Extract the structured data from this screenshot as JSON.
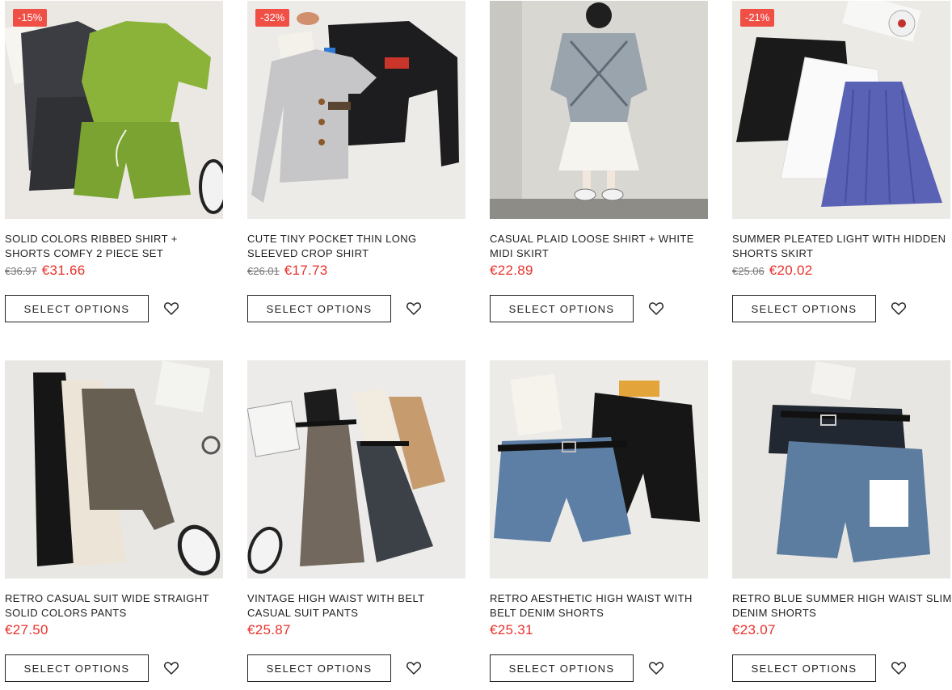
{
  "products": [
    {
      "title": "SOLID COLORS RIBBED SHIRT + SHORTS COMFY 2 PIECE SET",
      "badge": "-15%",
      "old_price": "€36.97",
      "price": "€31.66",
      "button": "SELECT OPTIONS",
      "wishlist_icon": "heart-icon"
    },
    {
      "title": "CUTE TINY POCKET THIN LONG SLEEVED CROP SHIRT",
      "badge": "-32%",
      "old_price": "€26.01",
      "price": "€17.73",
      "button": "SELECT OPTIONS",
      "wishlist_icon": "heart-icon"
    },
    {
      "title": "CASUAL PLAID LOOSE SHIRT + WHITE MIDI SKIRT",
      "badge": null,
      "old_price": null,
      "price": "€22.89",
      "button": "SELECT OPTIONS",
      "wishlist_icon": "heart-icon"
    },
    {
      "title": "SUMMER PLEATED LIGHT WITH HIDDEN SHORTS SKIRT",
      "badge": "-21%",
      "old_price": "€25.06",
      "price": "€20.02",
      "button": "SELECT OPTIONS",
      "wishlist_icon": "heart-icon"
    },
    {
      "title": "RETRO CASUAL SUIT WIDE STRAIGHT SOLID COLORS PANTS",
      "badge": null,
      "old_price": null,
      "price": "€27.50",
      "button": "SELECT OPTIONS",
      "wishlist_icon": "heart-icon"
    },
    {
      "title": "VINTAGE HIGH WAIST WITH BELT CASUAL SUIT PANTS",
      "badge": null,
      "old_price": null,
      "price": "€25.87",
      "button": "SELECT OPTIONS",
      "wishlist_icon": "heart-icon"
    },
    {
      "title": "RETRO AESTHETIC HIGH WAIST WITH BELT DENIM SHORTS",
      "badge": null,
      "old_price": null,
      "price": "€25.31",
      "button": "SELECT OPTIONS",
      "wishlist_icon": "heart-icon"
    },
    {
      "title": "RETRO BLUE SUMMER HIGH WAIST SLIM DENIM SHORTS",
      "badge": null,
      "old_price": null,
      "price": "€23.07",
      "button": "SELECT OPTIONS",
      "wishlist_icon": "heart-icon"
    }
  ],
  "colors": {
    "accent": "#e8322c",
    "badge": "#f04f46"
  }
}
